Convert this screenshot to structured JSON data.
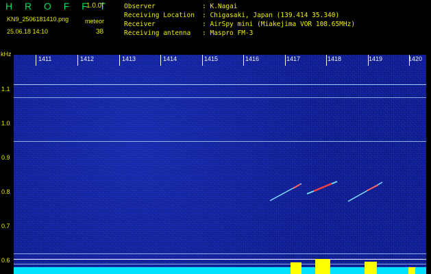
{
  "header": {
    "logo": "H R O F F T",
    "version": "1.0.0f",
    "filename": "KN9_2506181410.png",
    "timestamp": "25.06.18 14:10",
    "meteor_label": "meteor",
    "meteor_count": "38"
  },
  "info": [
    {
      "key": "Observer",
      "value": ": K.Nagai"
    },
    {
      "key": "Receiving Location",
      "value": ": Chigasaki, Japan (139.414 35.340)"
    },
    {
      "key": "Receiver",
      "value": ": AirSpy mini (Miakejima VOR 108.65MHz)"
    },
    {
      "key": "Receiving antenna",
      "value": ": Maspro FM-3"
    }
  ],
  "axis": {
    "y_unit": "kHz",
    "y_labels": [
      "1.1",
      "1.0",
      "0.9",
      "0.8",
      "0.7",
      "0.6"
    ],
    "x_labels": [
      "1411",
      "1412",
      "1413",
      "1414",
      "1415",
      "1416",
      "1417",
      "1418",
      "1419",
      "1420"
    ]
  },
  "colors": {
    "background": "#000000",
    "spectrogram": "#1424a8",
    "label_yellow": "#e8e800",
    "logo_green": "#00e060",
    "trace_cyan": "#00e0ff",
    "signal_yellow": "#ffff00"
  }
}
